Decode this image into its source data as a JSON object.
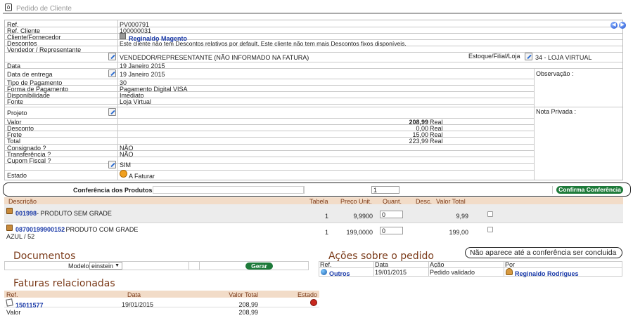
{
  "header": {
    "title": "Pedido de Cliente"
  },
  "order": {
    "ref_label": "Ref.",
    "ref_value": "PV000791",
    "refcli_label": "Ref. Cliente",
    "refcli_value": "100000031",
    "client_label": "Cliente/Fornecedor",
    "client_value": "Reginaldo Magento",
    "desc_label": "Descontos",
    "desc_value": "Este cliente não tem Descontos relativos por default. Este cliente não tem mais Descontos fixos disponíveis.",
    "vend_label": "Vendedor / Representante",
    "vend_value": "VENDEDOR/REPRESENTANTE (NÃO INFORMADO NA FATURA)",
    "estoque_label": "Estoque/Filial/Loja",
    "estoque_value": "34 - LOJA VIRTUAL",
    "data_label": "Data",
    "data_value": "19 Janeiro 2015",
    "entrega_label": "Data de entrega",
    "entrega_value": "19 Janeiro 2015",
    "obs_label": "Observação :",
    "tipo_label": "Tipo de Pagamento",
    "tipo_value": "30",
    "forma_label": "Forma de Pagamento",
    "forma_value": "Pagamento Digital VISA",
    "disp_label": "Disponibilidade",
    "disp_value": "Imediato",
    "fonte_label": "Fonte",
    "fonte_value": "Loja Virtual",
    "projeto_label": "Projeto",
    "nota_label": "Nota Privada :",
    "valor_label": "Valor",
    "valor_value": "208,99",
    "valor_cur": "Real",
    "desconto_label": "Desconto",
    "desconto_value": "0,00",
    "desconto_cur": "Real",
    "frete_label": "Frete",
    "frete_value": "15,00",
    "frete_cur": "Real",
    "total_label": "Total",
    "total_value": "223,99",
    "total_cur": "Real",
    "consig_label": "Consignado ?",
    "consig_value": "NÃO",
    "transf_label": "Transferência ?",
    "transf_value": "NÃO",
    "cupom_label": "Cupom Fiscal ?",
    "cupom_value": "SIM",
    "estado_label": "Estado",
    "estado_value": "A Faturar"
  },
  "conference": {
    "label": "Conferência dos Produtos:",
    "qty_value": "1",
    "button": "Confirma Conferência"
  },
  "lines": {
    "headers": {
      "descricao": "Descrição",
      "tabela": "Tabela",
      "preco": "Preço Unit.",
      "quant": "Quant.",
      "desc": "Desc.",
      "valor": "Valor Total"
    },
    "rows": [
      {
        "code": "001998",
        "name": " - PRODUTO SEM GRADE",
        "sub": "",
        "tabela": "1",
        "preco": "9,9900",
        "quant": "0",
        "valor": "9,99"
      },
      {
        "code": "08700199900152",
        "name": " - PRODUTO COM GRADE",
        "sub": "AZUL / 52",
        "tabela": "1",
        "preco": "199,0000",
        "quant": "0",
        "valor": "199,00"
      }
    ]
  },
  "documents": {
    "title": "Documentos",
    "modelo_label": "Modelo",
    "modelo_value": "einstein",
    "button": "Gerar"
  },
  "actions": {
    "title": "Ações sobre o pedido",
    "note": "Não aparece até a conferência ser concluida",
    "headers": {
      "ref": "Ref.",
      "data": "Data",
      "acao": "Ação",
      "por": "Por"
    },
    "row": {
      "ref": "Outros",
      "data": "19/01/2015",
      "acao": "Pedido validado",
      "por": "Reginaldo Rodrigues"
    }
  },
  "invoices": {
    "title": "Faturas relacionadas",
    "headers": {
      "ref": "Ref.",
      "data": "Data",
      "valor": "Valor Total",
      "estado": "Estado"
    },
    "row": {
      "ref": "15011577",
      "data": "19/01/2015",
      "valor": "208,99"
    },
    "footer_label": "Valor",
    "footer_value": "208,99"
  },
  "colors": {
    "accent": "#1e7a3a",
    "section_title": "#7b3b1a",
    "link": "#1a3aa8",
    "header_row": "#f2dcc8"
  }
}
